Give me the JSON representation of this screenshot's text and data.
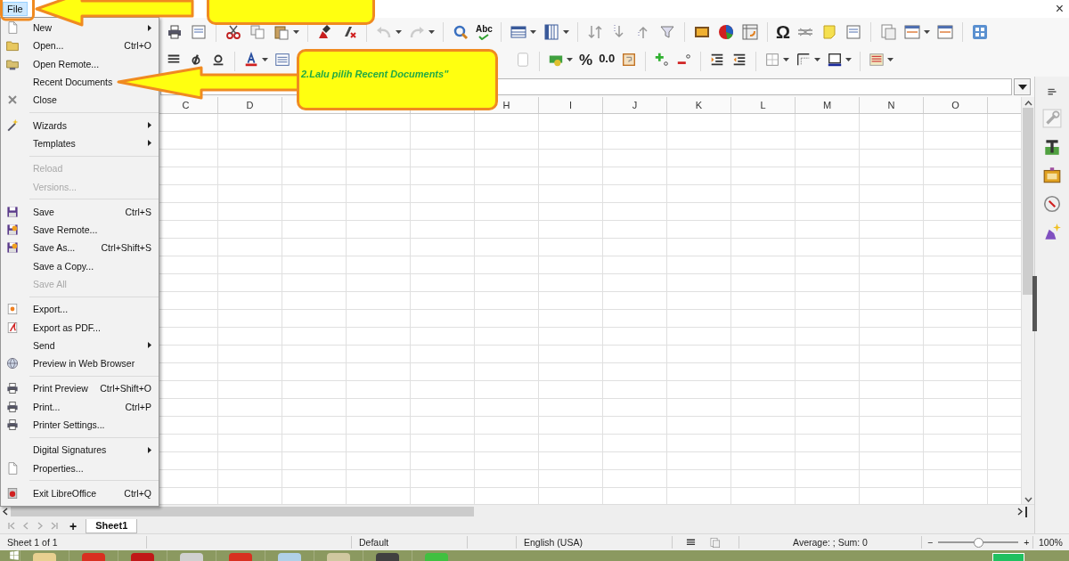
{
  "menubar": [
    {
      "label": "File",
      "selected": true
    }
  ],
  "window_close": "×",
  "toolbar_1": {
    "text_buttons": [
      "Abc",
      "Ω"
    ]
  },
  "toolbar_2": {
    "text_buttons": [
      "%",
      "0.0"
    ]
  },
  "file_menu": [
    {
      "kind": "item",
      "label": "New",
      "submenu": true,
      "disabled": false
    },
    {
      "kind": "item",
      "label": "Open...",
      "shortcut": "Ctrl+O",
      "submenu": false,
      "disabled": false
    },
    {
      "kind": "item",
      "label": "Open Remote...",
      "submenu": false,
      "disabled": false
    },
    {
      "kind": "item",
      "label": "Recent Documents",
      "submenu": false,
      "disabled": false
    },
    {
      "kind": "item",
      "label": "Close",
      "submenu": false,
      "disabled": false
    },
    {
      "kind": "separator"
    },
    {
      "kind": "item",
      "label": "Wizards",
      "submenu": true,
      "disabled": false
    },
    {
      "kind": "item",
      "label": "Templates",
      "submenu": true,
      "disabled": false
    },
    {
      "kind": "separator"
    },
    {
      "kind": "item",
      "label": "Reload",
      "submenu": false,
      "disabled": true
    },
    {
      "kind": "item",
      "label": "Versions...",
      "submenu": false,
      "disabled": true
    },
    {
      "kind": "separator"
    },
    {
      "kind": "item",
      "label": "Save",
      "shortcut": "Ctrl+S",
      "submenu": false,
      "disabled": false
    },
    {
      "kind": "item",
      "label": "Save Remote...",
      "submenu": false,
      "disabled": false
    },
    {
      "kind": "item",
      "label": "Save As...",
      "shortcut": "Ctrl+Shift+S",
      "submenu": false,
      "disabled": false
    },
    {
      "kind": "item",
      "label": "Save a Copy...",
      "submenu": false,
      "disabled": false
    },
    {
      "kind": "item",
      "label": "Save All",
      "submenu": false,
      "disabled": true
    },
    {
      "kind": "separator"
    },
    {
      "kind": "item",
      "label": "Export...",
      "submenu": false,
      "disabled": false
    },
    {
      "kind": "item",
      "label": "Export as PDF...",
      "submenu": false,
      "disabled": false
    },
    {
      "kind": "item",
      "label": "Send",
      "submenu": true,
      "disabled": false
    },
    {
      "kind": "item",
      "label": "Preview in Web Browser",
      "submenu": false,
      "disabled": false
    },
    {
      "kind": "separator"
    },
    {
      "kind": "item",
      "label": "Print Preview",
      "shortcut": "Ctrl+Shift+O",
      "submenu": false,
      "disabled": false
    },
    {
      "kind": "item",
      "label": "Print...",
      "shortcut": "Ctrl+P",
      "submenu": false,
      "disabled": false
    },
    {
      "kind": "item",
      "label": "Printer Settings...",
      "submenu": false,
      "disabled": false
    },
    {
      "kind": "separator"
    },
    {
      "kind": "item",
      "label": "Digital Signatures",
      "submenu": true,
      "disabled": false
    },
    {
      "kind": "item",
      "label": "Properties...",
      "submenu": false,
      "disabled": false
    },
    {
      "kind": "separator"
    },
    {
      "kind": "item",
      "label": "Exit LibreOffice",
      "shortcut": "Ctrl+Q",
      "submenu": false,
      "disabled": false
    }
  ],
  "columns": [
    "C",
    "D"
  ],
  "columns_after_callout": [
    "H",
    "I",
    "J",
    "K",
    "L",
    "M",
    "N",
    "O"
  ],
  "add_sheet": "+",
  "sheet_tabs": [
    {
      "label": "Sheet1",
      "selected": true
    }
  ],
  "status_bar": {
    "sheet": "Sheet 1 of 1",
    "page_style": "Default",
    "language": "English (USA)",
    "summary": "Average: ; Sum: 0",
    "zoom_out": "−",
    "zoom_in": "+",
    "zoom": {
      "level": 0.5
    },
    "zoom_percent": "100%"
  },
  "callouts": [
    {
      "text": "2.Lalu pilih Recent Documents\""
    }
  ]
}
